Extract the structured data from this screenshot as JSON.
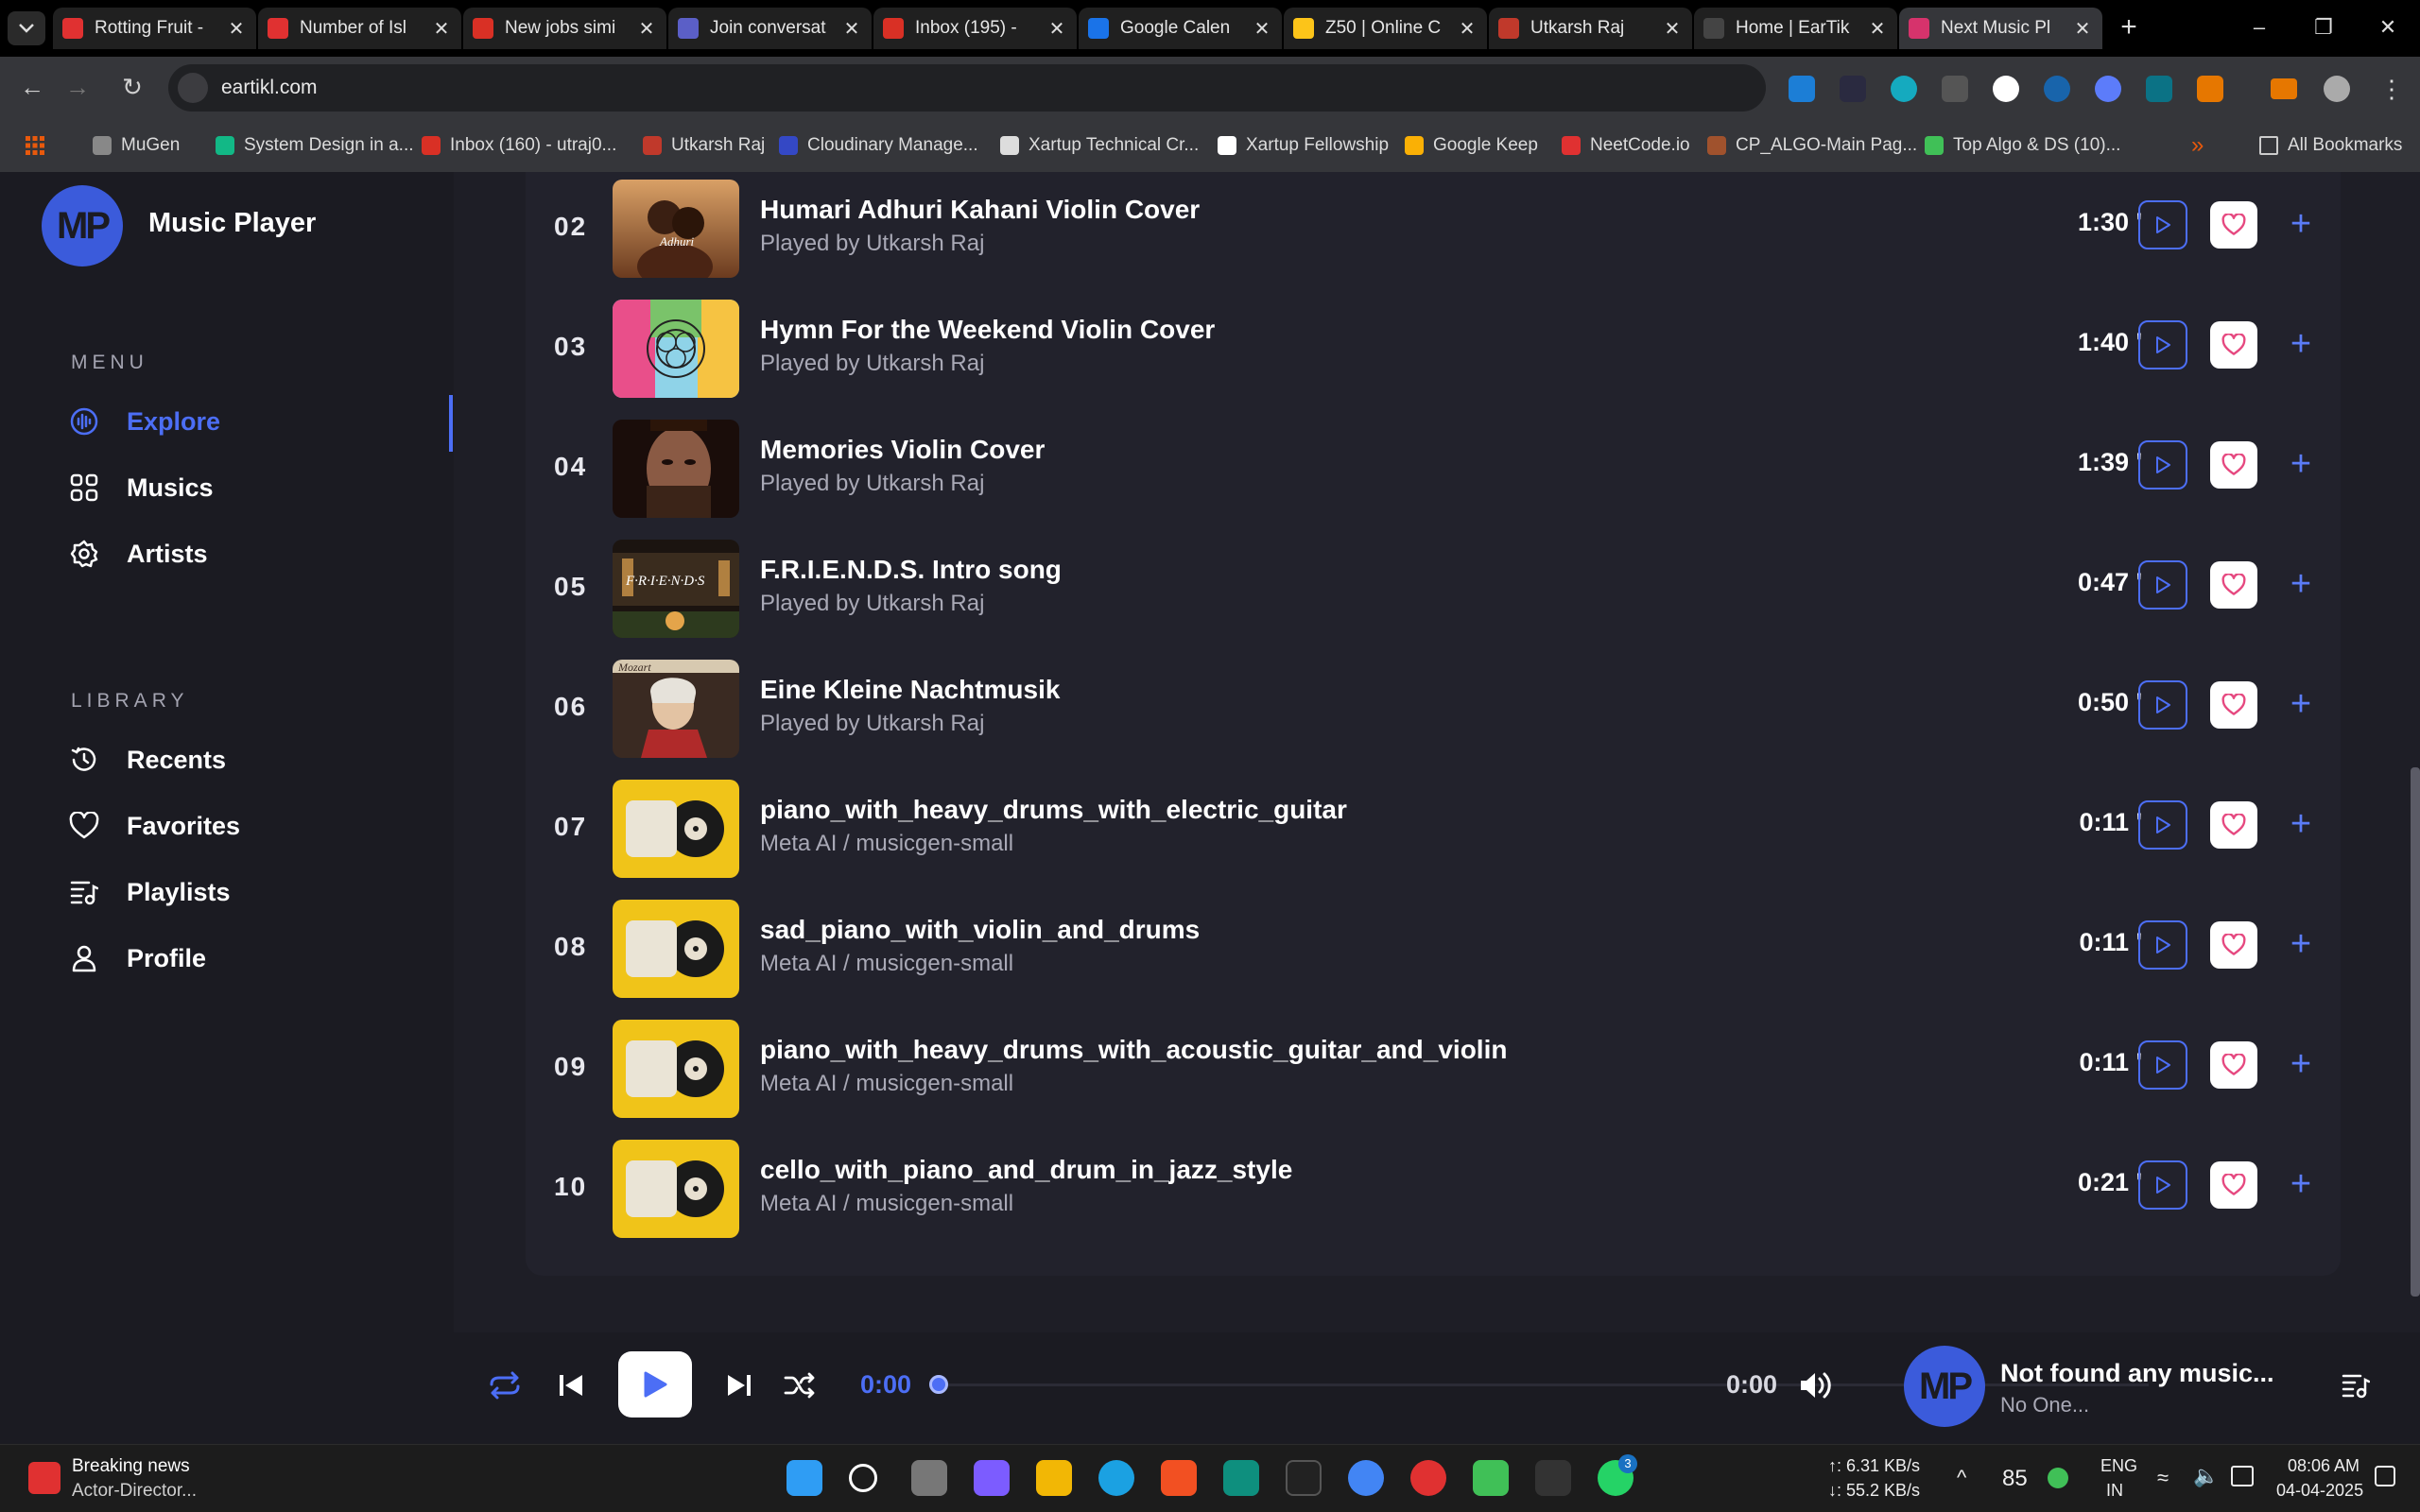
{
  "browser": {
    "tabs": [
      {
        "title": "Rotting Fruit -",
        "color": "#e03131"
      },
      {
        "title": "Number of Isl",
        "color": "#e03131"
      },
      {
        "title": "New jobs simi",
        "color": "#d93025"
      },
      {
        "title": "Join conversat",
        "color": "#5b5fc7"
      },
      {
        "title": "Inbox (195) - ",
        "color": "#d93025"
      },
      {
        "title": "Google Calen",
        "color": "#1a73e8"
      },
      {
        "title": "Z50 | Online C",
        "color": "#fcc419"
      },
      {
        "title": "Utkarsh Raj",
        "color": "#c0392b"
      },
      {
        "title": "Home | EarTik",
        "color": "#444"
      },
      {
        "title": "Next Music Pl",
        "color": "#d6336c"
      }
    ],
    "url": "eartikl.com",
    "bookmarks": [
      {
        "label": "MuGen",
        "color": "#888"
      },
      {
        "label": "System Design in a...",
        "color": "#12b886"
      },
      {
        "label": "Inbox (160) - utraj0...",
        "color": "#d93025"
      },
      {
        "label": "Utkarsh Raj",
        "color": "#c0392b"
      },
      {
        "label": "Cloudinary Manage...",
        "color": "#3448c5"
      },
      {
        "label": "Xartup Technical Cr...",
        "color": "#ddd"
      },
      {
        "label": "Xartup Fellowship",
        "color": "#fff"
      },
      {
        "label": "Google Keep",
        "color": "#fab005"
      },
      {
        "label": "NeetCode.io",
        "color": "#e03131"
      },
      {
        "label": "CP_ALGO-Main Pag...",
        "color": "#a0522d"
      },
      {
        "label": "Top Algo & DS (10)...",
        "color": "#40c057"
      }
    ],
    "all_bookmarks": "All Bookmarks",
    "more_chevron": "»"
  },
  "app": {
    "logo_text": "MP",
    "name": "Music Player",
    "menu_title": "MENU",
    "menu": [
      {
        "label": "Explore",
        "icon": "waveform-icon",
        "active": true
      },
      {
        "label": "Musics",
        "icon": "grid-icon"
      },
      {
        "label": "Artists",
        "icon": "gear-icon"
      }
    ],
    "library_title": "LIBRARY",
    "library": [
      {
        "label": "Recents",
        "icon": "history-icon"
      },
      {
        "label": "Favorites",
        "icon": "heart-icon"
      },
      {
        "label": "Playlists",
        "icon": "playlist-icon"
      },
      {
        "label": "Profile",
        "icon": "user-icon"
      }
    ],
    "accent": "#4c6ef5"
  },
  "tracks": [
    {
      "num": "02",
      "title": "Humari Adhuri Kahani Violin Cover",
      "artist": "Played by Utkarsh Raj",
      "duration": "1:30 '",
      "art": "romance"
    },
    {
      "num": "03",
      "title": "Hymn For the Weekend Violin Cover",
      "artist": "Played by Utkarsh Raj",
      "duration": "1:40 '",
      "art": "mandala"
    },
    {
      "num": "04",
      "title": "Memories Violin Cover",
      "artist": "Played by Utkarsh Raj",
      "duration": "1:39 '",
      "art": "portrait"
    },
    {
      "num": "05",
      "title": "F.R.I.E.N.D.S. Intro song",
      "artist": "Played by Utkarsh Raj",
      "duration": "0:47 '",
      "art": "friends"
    },
    {
      "num": "06",
      "title": "Eine Kleine Nachtmusik",
      "artist": "Played by Utkarsh Raj",
      "duration": "0:50 '",
      "art": "mozart"
    },
    {
      "num": "07",
      "title": "piano_with_heavy_drums_with_electric_guitar",
      "artist": "Meta AI / musicgen-small",
      "duration": "0:11 '",
      "art": "vinyl"
    },
    {
      "num": "08",
      "title": "sad_piano_with_violin_and_drums",
      "artist": "Meta AI / musicgen-small",
      "duration": "0:11 '",
      "art": "vinyl"
    },
    {
      "num": "09",
      "title": "piano_with_heavy_drums_with_acoustic_guitar_and_violin",
      "artist": "Meta AI / musicgen-small",
      "duration": "0:11 '",
      "art": "vinyl"
    },
    {
      "num": "10",
      "title": "cello_with_piano_and_drum_in_jazz_style",
      "artist": "Meta AI / musicgen-small",
      "duration": "0:21 '",
      "art": "vinyl"
    }
  ],
  "player": {
    "current_time": "0:00",
    "total_time": "0:00",
    "progress": 0,
    "now_playing_title": "Not found any music...",
    "now_playing_artist": "No One...",
    "logo_text": "MP"
  },
  "taskbar": {
    "news_title": "Breaking news",
    "news_sub": "Actor-Director...",
    "net_up": "↑: 6.31 KB/s",
    "net_down": "↓: 55.2 KB/s",
    "battery": "85",
    "lang1": "ENG",
    "lang2": "IN",
    "time": "08:06 AM",
    "date": "04-04-2025",
    "whatsapp_badge": "3"
  }
}
